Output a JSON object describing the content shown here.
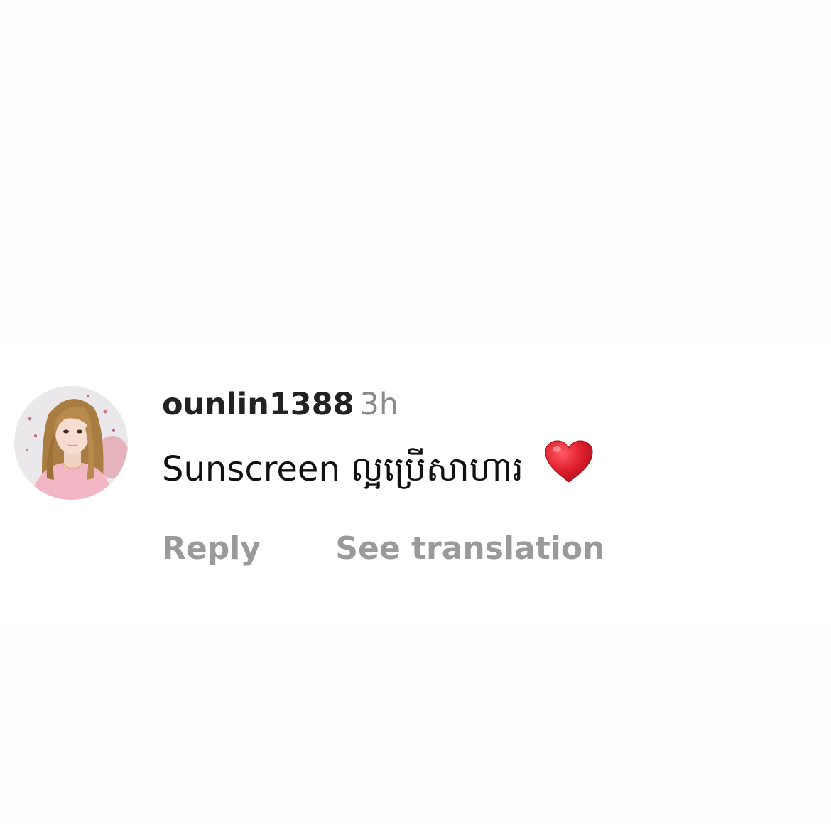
{
  "comment": {
    "username": "ounlin1388",
    "timestamp": "3h",
    "text": "Sunscreen ល្អប្រើសាហារ",
    "emoji_icon": "red-heart-icon",
    "avatar_icon": "profile-photo-avatar"
  },
  "actions": {
    "reply_label": "Reply",
    "translate_label": "See translation"
  },
  "colors": {
    "heart": "#e0202e",
    "secondary_text": "#9a9a9a",
    "primary_text": "#111111"
  }
}
